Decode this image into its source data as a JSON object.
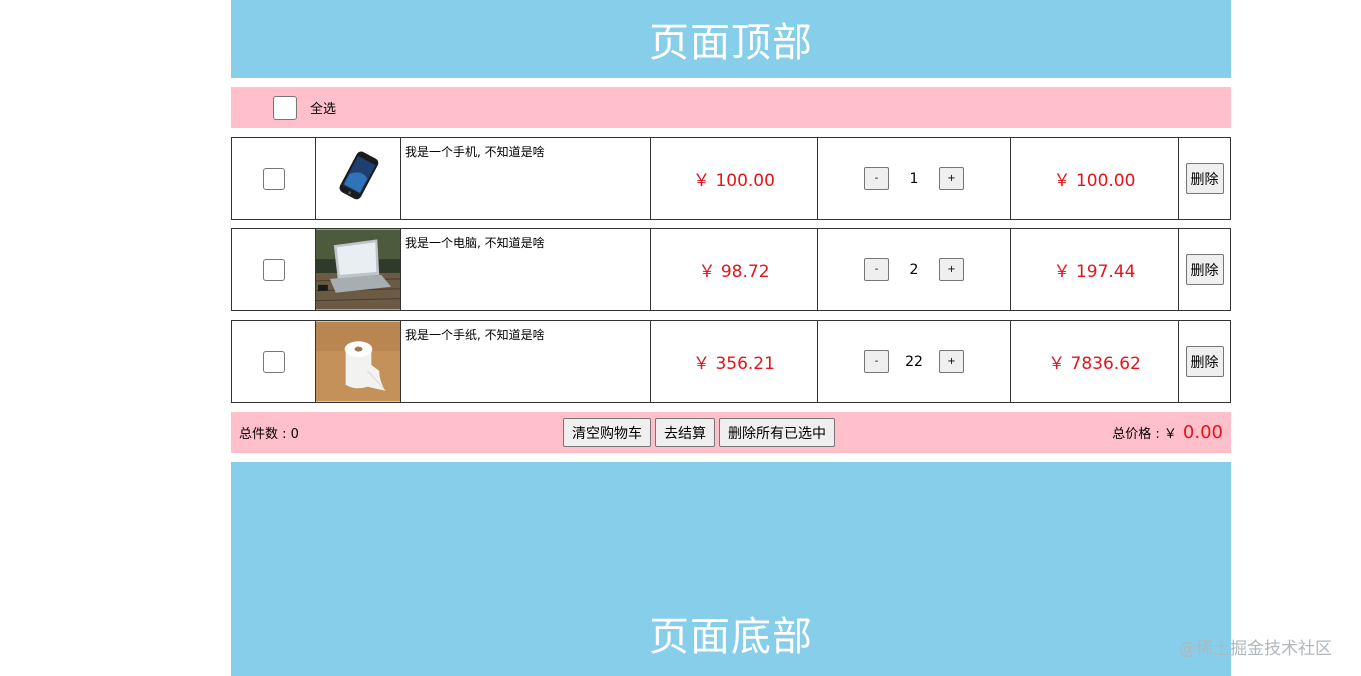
{
  "header": {
    "title": "页面顶部"
  },
  "select_all": {
    "label": "全选",
    "checked": false
  },
  "items": [
    {
      "name": "我是一个手机, 不知道是啥",
      "price": "￥ 100.00",
      "qty": "1",
      "subtotal": "￥ 100.00",
      "delete_label": "删除",
      "checked": false,
      "image": "phone-image"
    },
    {
      "name": "我是一个电脑, 不知道是啥",
      "price": "￥ 98.72",
      "qty": "2",
      "subtotal": "￥ 197.44",
      "delete_label": "删除",
      "checked": false,
      "image": "laptop-image"
    },
    {
      "name": "我是一个手纸, 不知道是啥",
      "price": "￥ 356.21",
      "qty": "22",
      "subtotal": "￥ 7836.62",
      "delete_label": "删除",
      "checked": false,
      "image": "toilet-paper-image"
    }
  ],
  "qty_controls": {
    "minus": "-",
    "plus": "+"
  },
  "footer": {
    "count_label": "总件数 : 0",
    "clear_label": "清空购物车",
    "checkout_label": "去结算",
    "delete_selected_label": "删除所有已选中",
    "total_label": "总价格 : ￥",
    "total_value": "0.00"
  },
  "bottom": {
    "title": "页面底部"
  },
  "watermark": "@稀土掘金技术社区",
  "colors": {
    "banner": "#87ceeb",
    "bar": "#ffc0cb",
    "price": "#e4141b"
  }
}
